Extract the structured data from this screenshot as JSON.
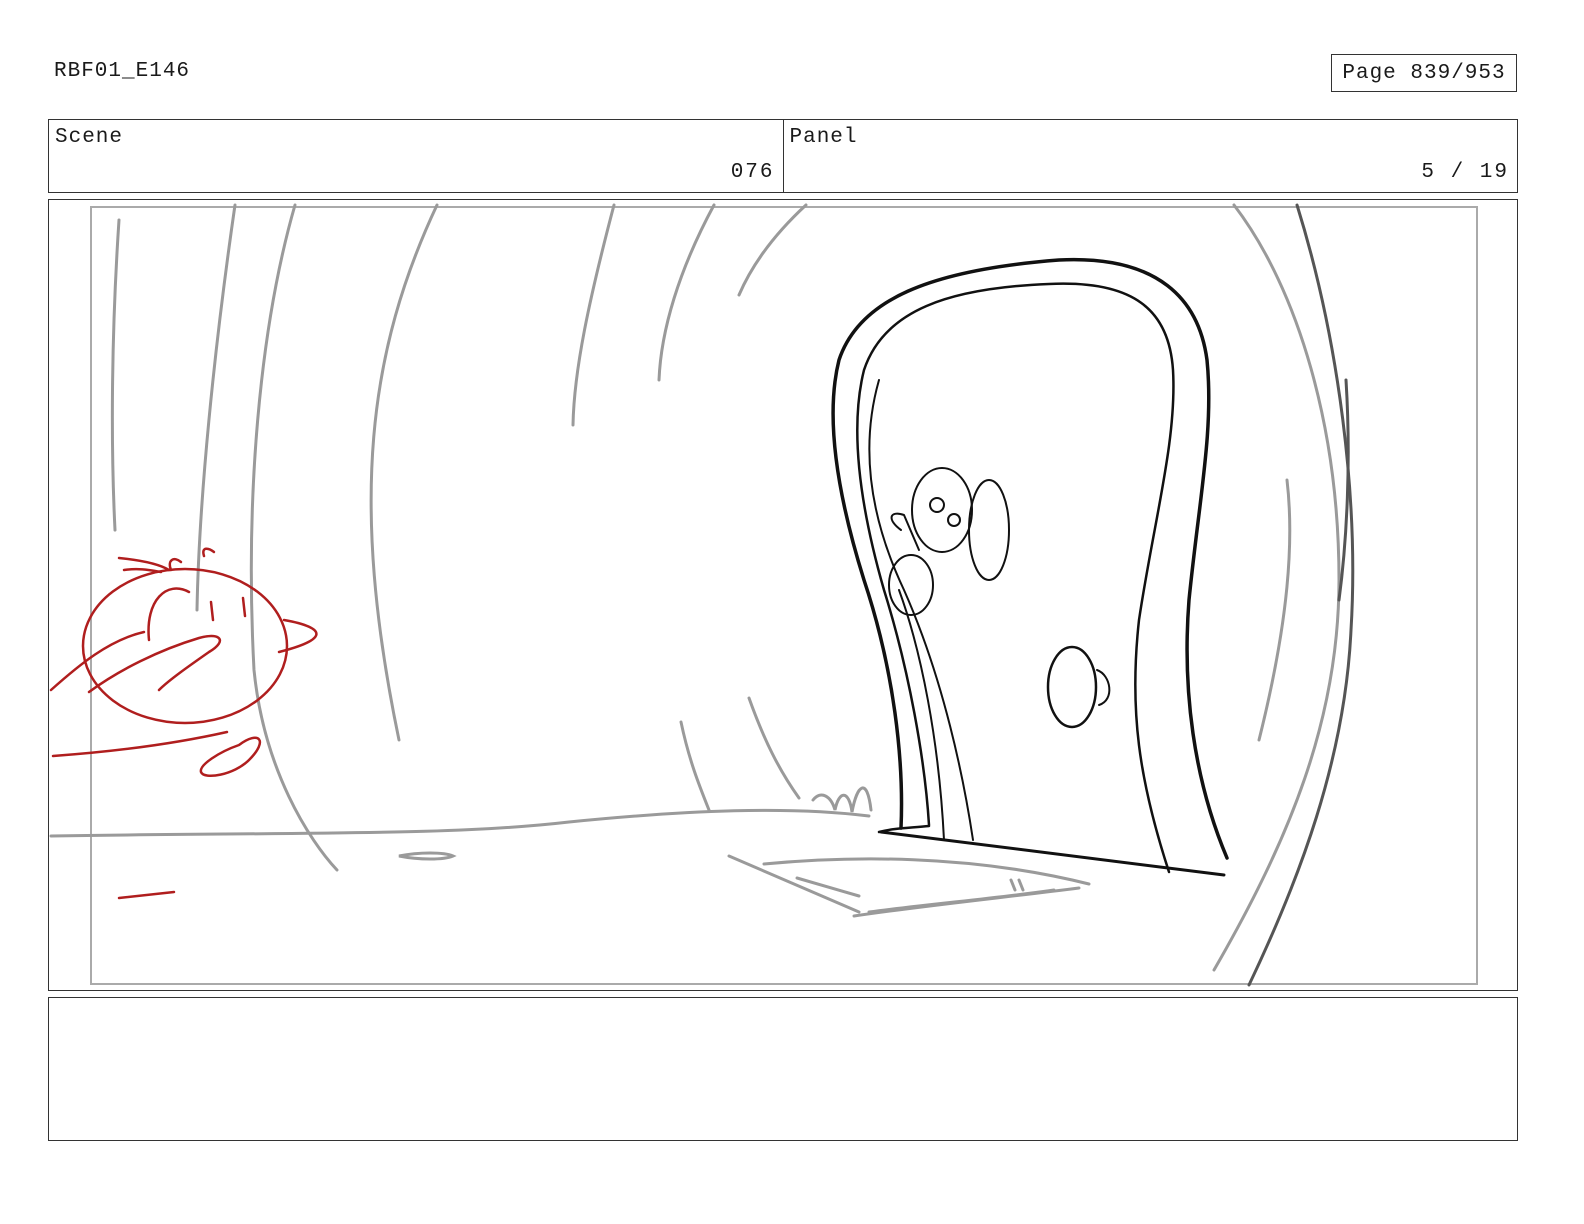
{
  "header": {
    "title": "RBF01_E146",
    "page": "Page 839/953"
  },
  "info": {
    "scene_label": "Scene",
    "scene_value": "076",
    "panel_label": "Panel",
    "panel_value": "5 / 19"
  },
  "drawing": {
    "colors": {
      "background_lines": "#9a9a9a",
      "door_lines": "#111111",
      "character_lines": "#b01e1e"
    }
  },
  "notes": {
    "text": ""
  }
}
